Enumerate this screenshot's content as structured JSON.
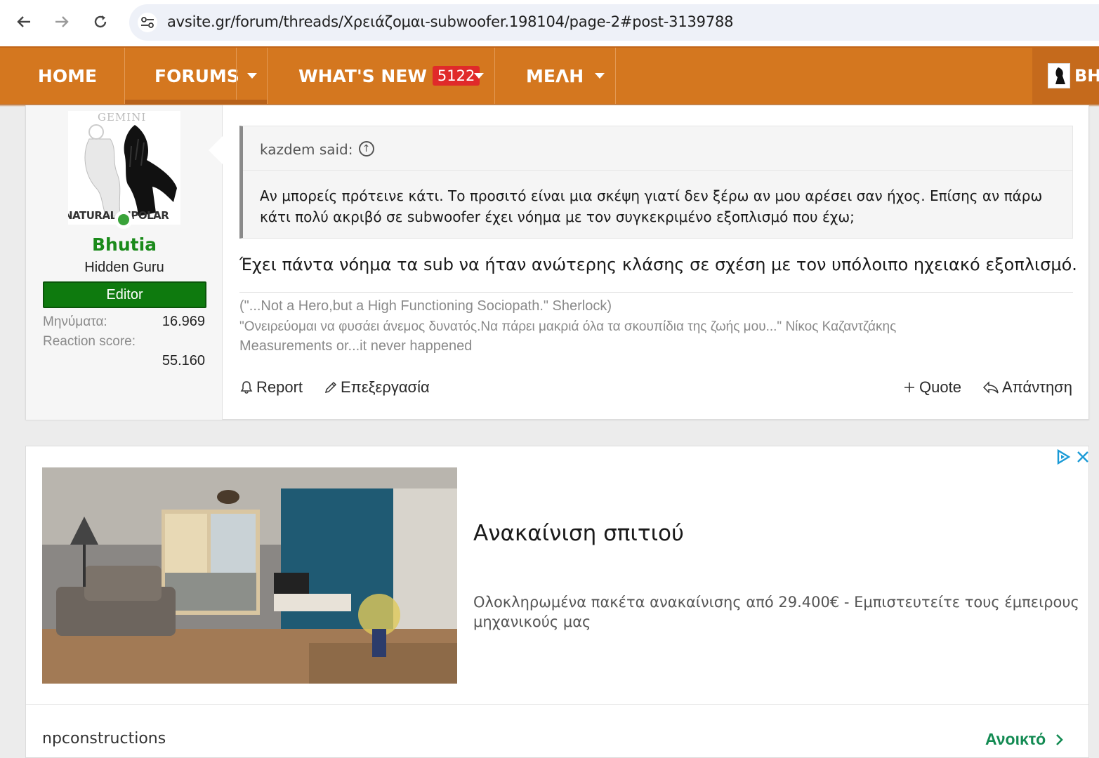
{
  "browser": {
    "url": "avsite.gr/forum/threads/Χρειάζομαι-subwoofer.198104/page-2#post-3139788"
  },
  "nav": {
    "home": "HOME",
    "forums": "FORUMS",
    "whats_new": "WHAT'S NEW",
    "whats_new_count": "5122",
    "members": "ΜΕΛΗ",
    "user_short": "BH"
  },
  "post": {
    "user": {
      "name": "Bhutia",
      "title": "Hidden Guru",
      "banner": "Editor",
      "messages_label": "Μηνύματα:",
      "messages_value": "16.969",
      "reaction_label": "Reaction score:",
      "reaction_value": "55.160",
      "avatar_top_text": "GEMINI",
      "avatar_bottom_text": "NATURAL BIPOLAR"
    },
    "quote": {
      "author": "kazdem said:",
      "text": "Αν μπορείς πρότεινε κάτι. Το προσιτό είναι μια σκέψη γιατί δεν ξέρω αν μου αρέσει σαν ήχος. Επίσης αν πάρω κάτι πολύ ακριβό σε subwoofer έχει νόημα με τον συγκεκριμένο εξοπλισμό που έχω;"
    },
    "message": "Έχει πάντα νόημα τα sub να ήταν ανώτερης κλάσης σε σχέση με τον υπόλοιπο ηχειακό εξοπλισμό.",
    "signature": [
      "(\"...Not a Hero,but a High Functioning Sociopath.\" Sherlock)",
      "\"Ονειρεύομαι να φυσάει άνεμος δυνατός.Να πάρει μακριά όλα τα σκουπίδια της ζωής μου...\" Νίκος Καζαντζάκης",
      "Measurements or...it never happened"
    ],
    "actions": {
      "report": "Report",
      "edit": "Επεξεργασία",
      "quote": "Quote",
      "reply": "Απάντηση"
    }
  },
  "ad": {
    "title": "Ανακαίνιση σπιτιού",
    "description": "Ολοκληρωμένα πακέτα ανακαίνισης από 29.400€ - Εμπιστευτείτε τους έμπειρους μηχανικούς μας",
    "source": "npconstructions",
    "open": "Ανοικτό"
  },
  "colors": {
    "nav_orange": "#d4771f",
    "username_green": "#1a8a1a",
    "editor_banner": "#0e7a0e",
    "badge_red": "#e02a2a",
    "ad_link_green": "#128a52"
  }
}
